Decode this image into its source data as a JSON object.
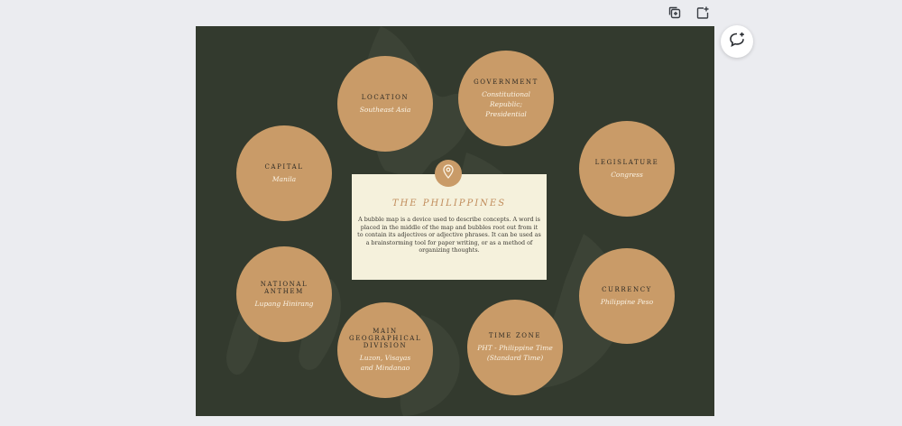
{
  "toolbar": {
    "duplicate_icon": "duplicate-page-icon",
    "add_page_icon": "add-page-icon",
    "comment_icon": "add-comment-icon"
  },
  "center": {
    "title": "THE PHILIPPINES",
    "description": "A bubble map is a device used to describe concepts. A word is placed in the middle of the map and bubbles root out from it to contain its adjectives or adjective phrases. It can be used as a brainstorming tool for paper writing, or as a method of organizing thoughts.",
    "icon": "location-pin-icon"
  },
  "bubbles": [
    {
      "title": "LOCATION",
      "value": "Southeast Asia"
    },
    {
      "title": "GOVERNMENT",
      "value": "Constitutional Republic; Presidential"
    },
    {
      "title": "CAPITAL",
      "value": "Manila"
    },
    {
      "title": "LEGISLATURE",
      "value": "Congress"
    },
    {
      "title": "NATIONAL ANTHEM",
      "value": "Lupang Hinirang"
    },
    {
      "title": "CURRENCY",
      "value": "Philippine Peso"
    },
    {
      "title": "MAIN GEOGRAPHICAL DIVISION",
      "value": "Luzon, Visayas and Mindanao"
    },
    {
      "title": "TIME ZONE",
      "value": "PHT - Philippine Time (Standard Time)"
    }
  ],
  "colors": {
    "canvas": "#333a2e",
    "bubble": "#c99b68",
    "center_box": "#f5f1dc",
    "accent_title": "#c08b5a"
  }
}
